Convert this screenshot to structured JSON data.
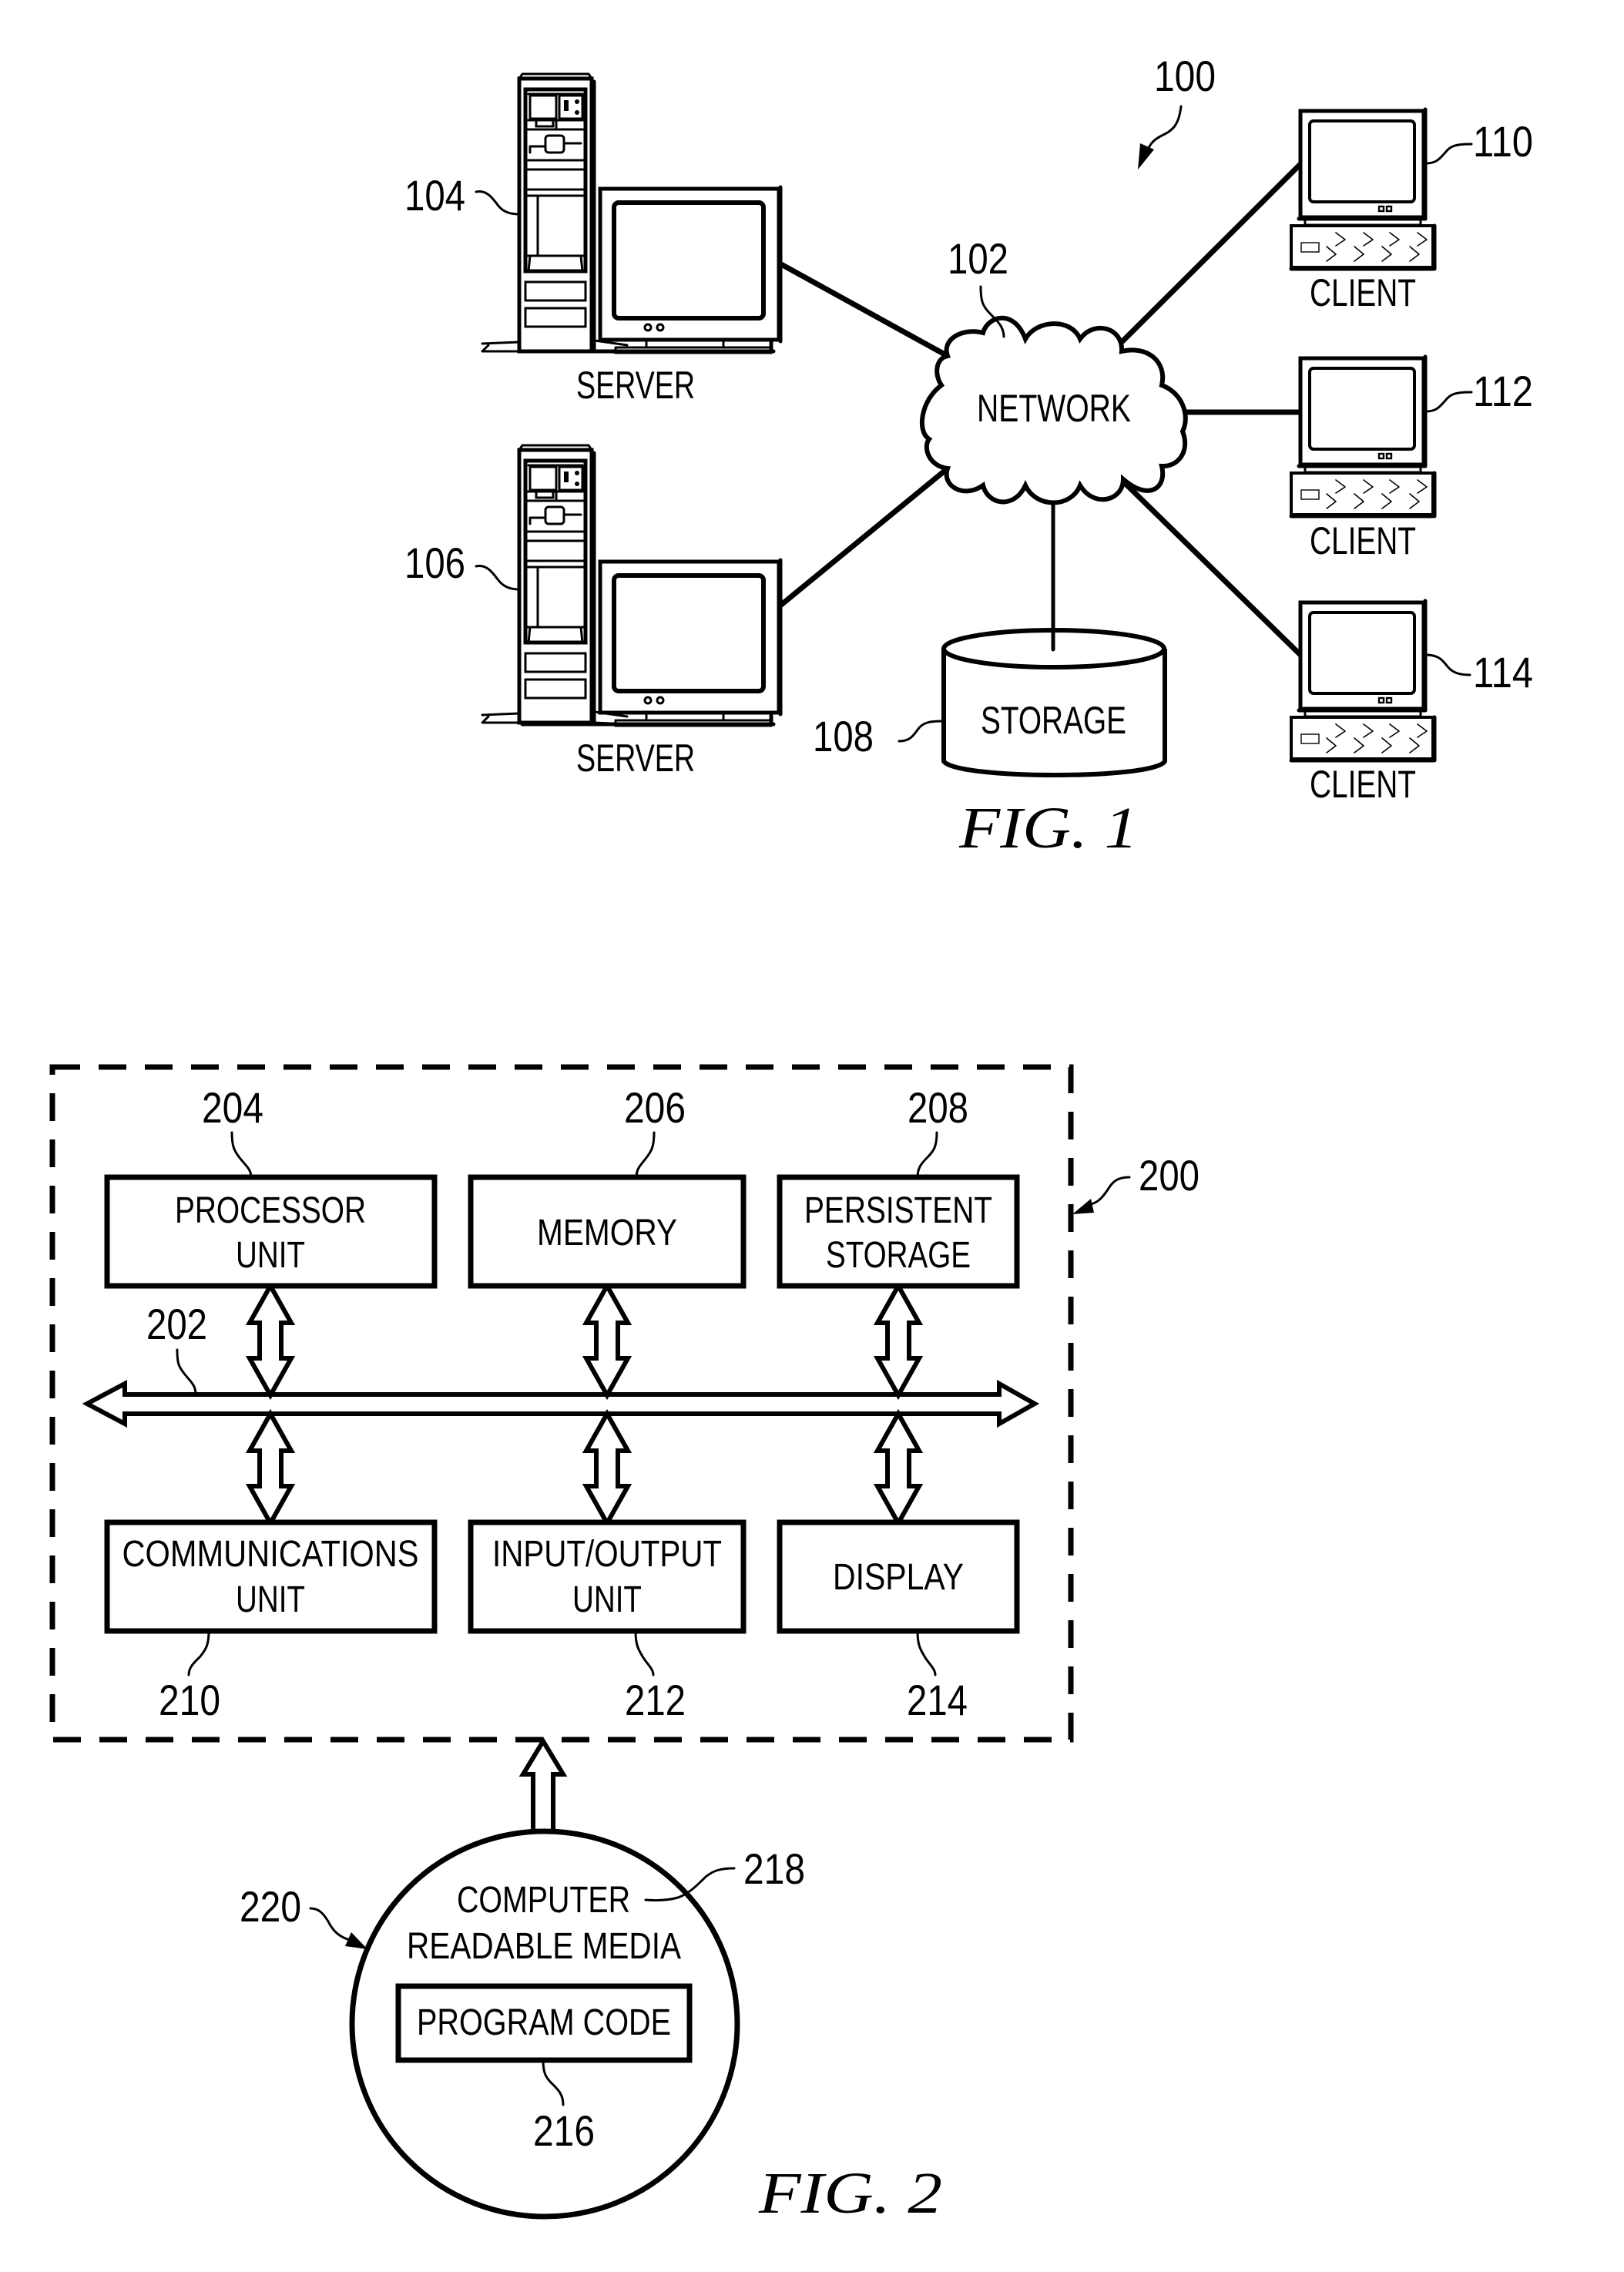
{
  "fig1": {
    "title": "FIG. 1",
    "ref_system": "100",
    "network": {
      "ref": "102",
      "label": "NETWORK"
    },
    "servers": [
      {
        "ref": "104",
        "label": "SERVER"
      },
      {
        "ref": "106",
        "label": "SERVER"
      }
    ],
    "storage": {
      "ref": "108",
      "label": "STORAGE"
    },
    "clients": [
      {
        "ref": "110",
        "label": "CLIENT"
      },
      {
        "ref": "112",
        "label": "CLIENT"
      },
      {
        "ref": "114",
        "label": "CLIENT"
      }
    ]
  },
  "fig2": {
    "title": "FIG. 2",
    "ref_system": "200",
    "bus_ref": "202",
    "top_units": [
      {
        "ref": "204",
        "lines": [
          "PROCESSOR",
          "UNIT"
        ]
      },
      {
        "ref": "206",
        "lines": [
          "MEMORY"
        ]
      },
      {
        "ref": "208",
        "lines": [
          "PERSISTENT",
          "STORAGE"
        ]
      }
    ],
    "bottom_units": [
      {
        "ref": "210",
        "lines": [
          "COMMUNICATIONS",
          "UNIT"
        ]
      },
      {
        "ref": "212",
        "lines": [
          "INPUT/OUTPUT",
          "UNIT"
        ]
      },
      {
        "ref": "214",
        "lines": [
          "DISPLAY"
        ]
      }
    ],
    "media": {
      "ref_product": "220",
      "ref_media": "218",
      "lines": [
        "COMPUTER",
        "READABLE MEDIA"
      ],
      "program_code": {
        "ref": "216",
        "label": "PROGRAM CODE"
      }
    }
  }
}
